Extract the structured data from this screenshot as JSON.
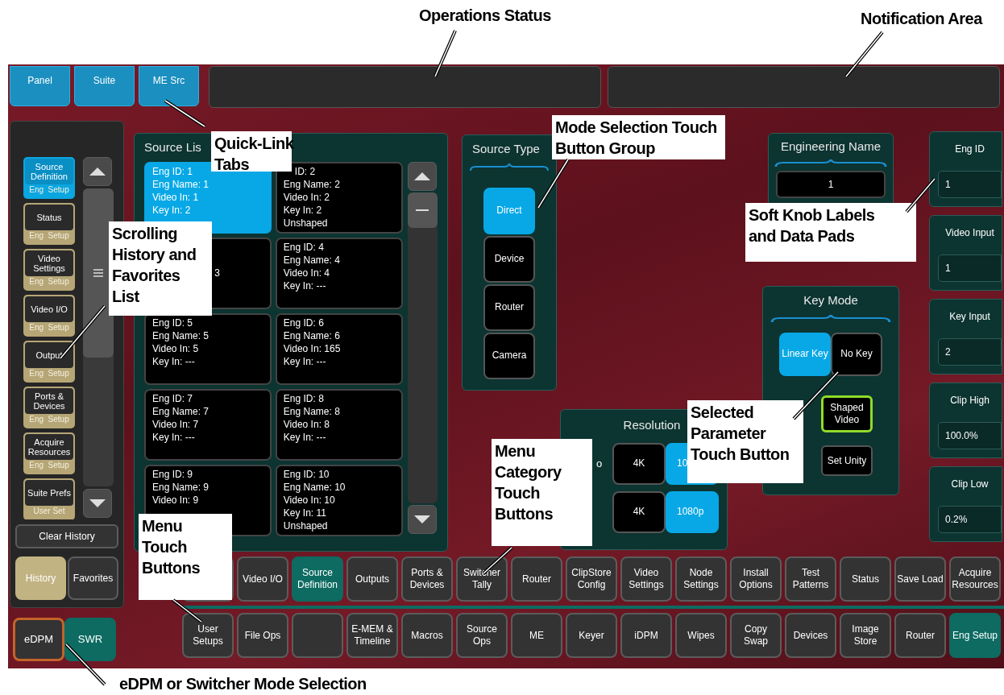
{
  "annotations": [
    {
      "lines": [
        "Operations Status"
      ],
      "boxed": false
    },
    {
      "lines": [
        "Notification Area"
      ],
      "boxed": false
    },
    {
      "lines": [
        "Quick-Link",
        "Tabs"
      ],
      "boxed": true
    },
    {
      "lines": [
        "Mode Selection Touch",
        "Button Group"
      ],
      "boxed": true
    },
    {
      "lines": [
        "Soft Knob Labels",
        "and Data Pads"
      ],
      "boxed": true
    },
    {
      "lines": [
        "Scrolling",
        "History and",
        "Favorites",
        "List"
      ],
      "boxed": true
    },
    {
      "lines": [
        "Selected",
        "Parameter",
        "Touch Button"
      ],
      "boxed": true
    },
    {
      "lines": [
        "Menu",
        "Category",
        "Touch",
        "Buttons"
      ],
      "boxed": true
    },
    {
      "lines": [
        "Menu",
        "Touch",
        "Buttons"
      ],
      "boxed": true
    },
    {
      "lines": [
        "eDPM or Switcher Mode Selection"
      ],
      "boxed": false
    }
  ],
  "quick_link_tabs": [
    {
      "label": "Panel"
    },
    {
      "label": "Suite"
    },
    {
      "label": "ME Src"
    }
  ],
  "sidebar": {
    "items": [
      {
        "title": "Source Definition",
        "subtitle": "Eng  Setup",
        "selected": true
      },
      {
        "title": "Status",
        "subtitle": "Eng  Setup",
        "selected": false
      },
      {
        "title": "Video Settings",
        "subtitle": "Eng  Setup",
        "selected": false
      },
      {
        "title": "Video I/O",
        "subtitle": "Eng  Setup",
        "selected": false
      },
      {
        "title": "Output",
        "subtitle": "Eng  Setup",
        "selected": false
      },
      {
        "title": "Ports & Devices",
        "subtitle": "Eng  Setup",
        "selected": false
      },
      {
        "title": "Acquire Resources",
        "subtitle": "Eng  Setup",
        "selected": false
      },
      {
        "title": "Suite Prefs",
        "subtitle": "User Set",
        "selected": false
      }
    ],
    "clear_button": "Clear History",
    "tabs": [
      {
        "label": "History",
        "selected": true
      },
      {
        "label": "Favorites",
        "selected": false
      }
    ]
  },
  "mode_buttons": [
    {
      "label": "eDPM",
      "selected": true
    },
    {
      "label": "SWR",
      "selected": false
    }
  ],
  "source_list": {
    "title": "Source Lis",
    "cards": [
      {
        "lines": [
          "Eng ID: 1",
          "Eng Name: 1",
          "Video In: 1",
          "Key In: 2"
        ],
        "selected": true
      },
      {
        "lines": [
          "ID: 2",
          "Eng Name: 2",
          "Video In: 2",
          "Key In: 2",
          "Unshaped"
        ],
        "selected": false
      },
      {
        "lines": [
          "3"
        ],
        "selected": false
      },
      {
        "lines": [
          "Eng ID: 4",
          "Eng Name: 4",
          "Video In: 4",
          "Key In: ---"
        ],
        "selected": false
      },
      {
        "lines": [
          "Eng ID: 5",
          "Eng Name: 5",
          "Video In: 5",
          "Key In: ---"
        ],
        "selected": false
      },
      {
        "lines": [
          "Eng ID: 6",
          "Eng Name: 6",
          "Video In: 165",
          "Key In: ---"
        ],
        "selected": false
      },
      {
        "lines": [
          "Eng ID: 7",
          "Eng Name: 7",
          "Video In: 7",
          "Key In: ---"
        ],
        "selected": false
      },
      {
        "lines": [
          "Eng ID: 8",
          "Eng Name: 8",
          "Video In: 8",
          "Key In: ---"
        ],
        "selected": false
      },
      {
        "lines": [
          "Eng ID: 9",
          "Eng Name: 9",
          "Video In: 9"
        ],
        "selected": false
      },
      {
        "lines": [
          "Eng ID: 10",
          "Eng Name: 10",
          "Video In: 10",
          "Key In: 11",
          "Unshaped"
        ],
        "selected": false
      }
    ]
  },
  "source_type": {
    "title": "Source Type",
    "buttons": [
      {
        "label": "Direct",
        "selected": true
      },
      {
        "label": "Device",
        "selected": false
      },
      {
        "label": "Router",
        "selected": false
      },
      {
        "label": "Camera",
        "selected": false
      }
    ]
  },
  "resolution": {
    "title": "Resolution",
    "rows": [
      {
        "label": "o",
        "buttons": [
          {
            "label": "4K",
            "selected": false
          },
          {
            "label": "10",
            "selected": true
          }
        ]
      },
      {
        "buttons": [
          {
            "label": "4K",
            "selected": false
          },
          {
            "label": "1080p",
            "selected": true
          }
        ]
      }
    ]
  },
  "engineering_name": {
    "title": "Engineering Name",
    "value": "1"
  },
  "key_mode": {
    "title": "Key Mode",
    "buttons": [
      {
        "label": "Linear Key",
        "selected": true
      },
      {
        "label": "No Key",
        "selected": false
      }
    ],
    "shaped_video": {
      "label": "Shaped Video",
      "selected": true
    },
    "set_unity": "Set Unity"
  },
  "soft_knobs": [
    {
      "label": "Eng ID",
      "value": "1"
    },
    {
      "label": "Video Input",
      "value": "1"
    },
    {
      "label": "Key Input",
      "value": "2"
    },
    {
      "label": "Clip High",
      "value": "100.0%"
    },
    {
      "label": "Clip Low",
      "value": "0.2%"
    }
  ],
  "category_buttons": [
    {
      "kind": "blank",
      "selected": false
    },
    {
      "kind": "label",
      "label": "Video I/O",
      "selected": false
    },
    {
      "kind": "label",
      "label": "Source Definition",
      "selected": true
    },
    {
      "kind": "label",
      "label": "Outputs",
      "selected": false
    },
    {
      "kind": "label",
      "label": "Ports & Devices",
      "selected": false
    },
    {
      "kind": "label",
      "label": "Switcher Tally",
      "selected": false
    },
    {
      "kind": "label",
      "label": "Router",
      "selected": false
    },
    {
      "kind": "label",
      "label": "ClipStore Config",
      "selected": false
    },
    {
      "kind": "label",
      "label": "Video Settings",
      "selected": false
    },
    {
      "kind": "label",
      "label": "Node Settings",
      "selected": false
    },
    {
      "kind": "label",
      "label": "Install Options",
      "selected": false
    },
    {
      "kind": "label",
      "label": "Test Patterns",
      "selected": false
    },
    {
      "kind": "label",
      "label": "Status",
      "selected": false
    },
    {
      "kind": "label",
      "label": "Save Load",
      "selected": false
    },
    {
      "kind": "label",
      "label": "Acquire Resources",
      "selected": false
    }
  ],
  "menu_buttons": [
    {
      "kind": "label",
      "label": "User Setups",
      "selected": false
    },
    {
      "kind": "label",
      "label": "File Ops",
      "selected": false
    },
    {
      "kind": "blank",
      "selected": false
    },
    {
      "kind": "label",
      "label": "E-MEM & Timeline",
      "selected": false
    },
    {
      "kind": "label",
      "label": "Macros",
      "selected": false
    },
    {
      "kind": "label",
      "label": "Source Ops",
      "selected": false
    },
    {
      "kind": "label",
      "label": "ME",
      "selected": false
    },
    {
      "kind": "label",
      "label": "Keyer",
      "selected": false
    },
    {
      "kind": "label",
      "label": "iDPM",
      "selected": false
    },
    {
      "kind": "label",
      "label": "Wipes",
      "selected": false
    },
    {
      "kind": "label",
      "label": "Copy Swap",
      "selected": false
    },
    {
      "kind": "label",
      "label": "Devices",
      "selected": false
    },
    {
      "kind": "label",
      "label": "Image Store",
      "selected": false
    },
    {
      "kind": "label",
      "label": "Router",
      "selected": false
    },
    {
      "kind": "label",
      "label": "Eng Setup",
      "selected": true
    }
  ]
}
